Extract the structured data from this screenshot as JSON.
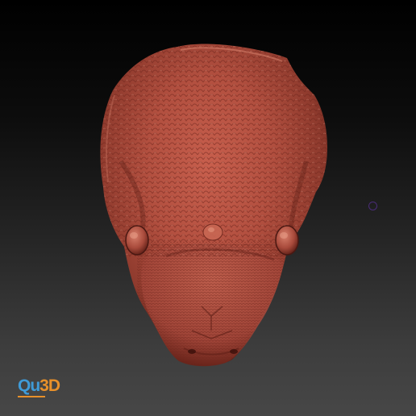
{
  "viewport": {
    "background_top": "#000000",
    "background_bottom": "#474747"
  },
  "model": {
    "description_icon": "sculpted-snake-head",
    "base_color": "#a8483a",
    "highlight_color": "#d0705e",
    "shadow_color": "#4a1812"
  },
  "watermark": {
    "part1": "Qu",
    "part2": "3D",
    "part1_color": "#3f9bd8",
    "part2_color": "#e8902a"
  },
  "cursor": {
    "icon": "brush-cursor-ring",
    "color": "#4a2c78"
  }
}
